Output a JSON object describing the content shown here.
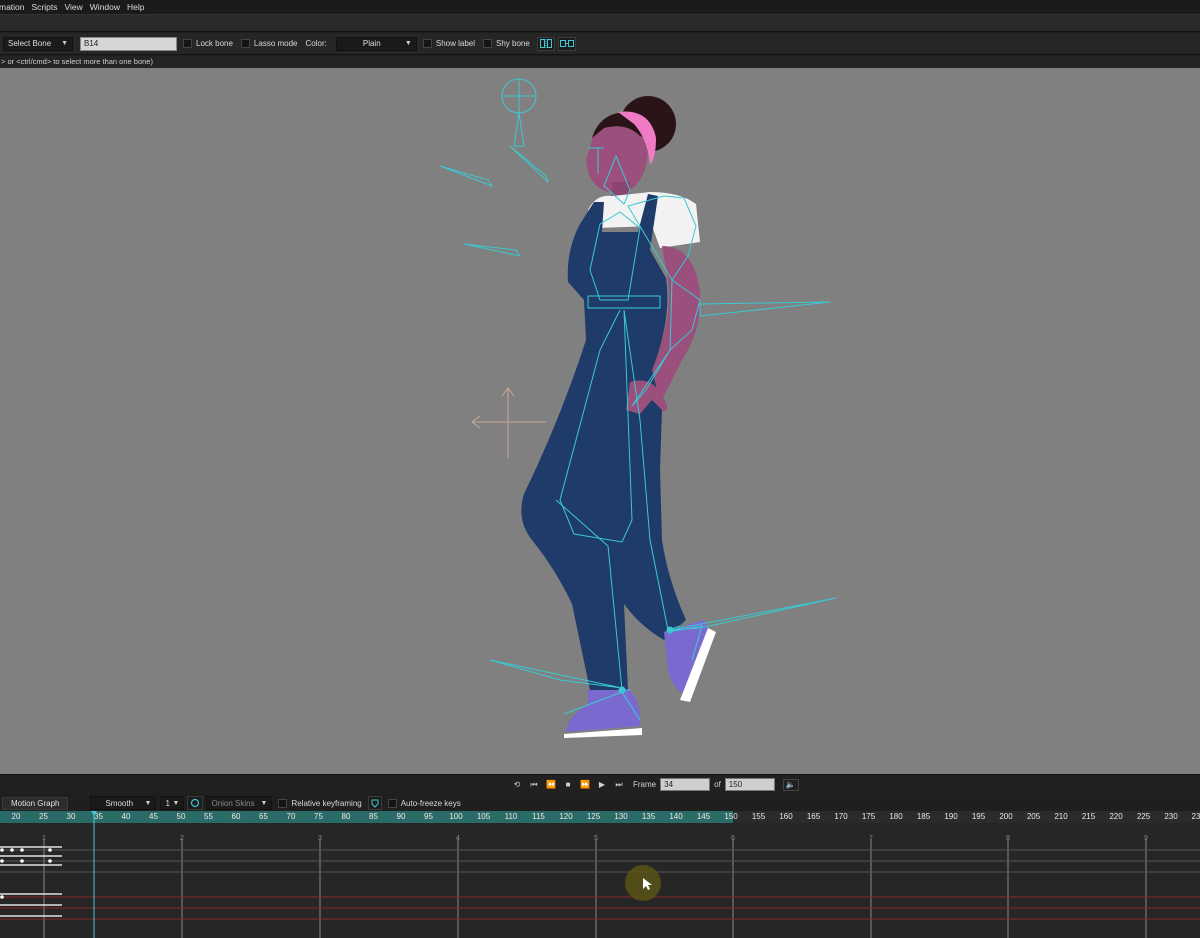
{
  "menu": {
    "items": [
      "mation",
      "Scripts",
      "View",
      "Window",
      "Help"
    ]
  },
  "toolbar": {
    "tool_select": "Select Bone",
    "bone_name": "B14",
    "lock_bone": "Lock bone",
    "lasso_mode": "Lasso mode",
    "color_label": "Color:",
    "color_value": "Plain",
    "show_label": "Show label",
    "shy_bone": "Shy bone"
  },
  "hint": "> or <ctrl/cmd> to select more than one bone)",
  "playback": {
    "frame_label": "Frame",
    "frame_value": "34",
    "of_label": "of",
    "total_frames": "150"
  },
  "timeline": {
    "tab_motion_graph": "Motion Graph",
    "interpolation": "Smooth",
    "interval": "1",
    "onion_skins": "Onion Skins",
    "relative_keyframing": "Relative keyframing",
    "auto_freeze_keys": "Auto-freeze keys",
    "ruler_labels": [
      "20",
      "25",
      "30",
      "35",
      "40",
      "45",
      "50",
      "55",
      "60",
      "65",
      "70",
      "75",
      "80",
      "85",
      "90",
      "95",
      "100",
      "105",
      "110",
      "115",
      "120",
      "125",
      "130",
      "135",
      "140",
      "145",
      "150",
      "155",
      "160",
      "165",
      "170",
      "175",
      "180",
      "185",
      "190",
      "195",
      "200",
      "205",
      "210",
      "215",
      "220",
      "225",
      "230",
      "23"
    ],
    "second_markers": [
      "1",
      "2",
      "3",
      "4",
      "5",
      "6",
      "7",
      "8",
      "9"
    ]
  },
  "colors": {
    "canvas": "#808080",
    "bone": "#3cc8d2",
    "timeline_played": "#2b6b67",
    "playhead": "#3cc8d2"
  }
}
